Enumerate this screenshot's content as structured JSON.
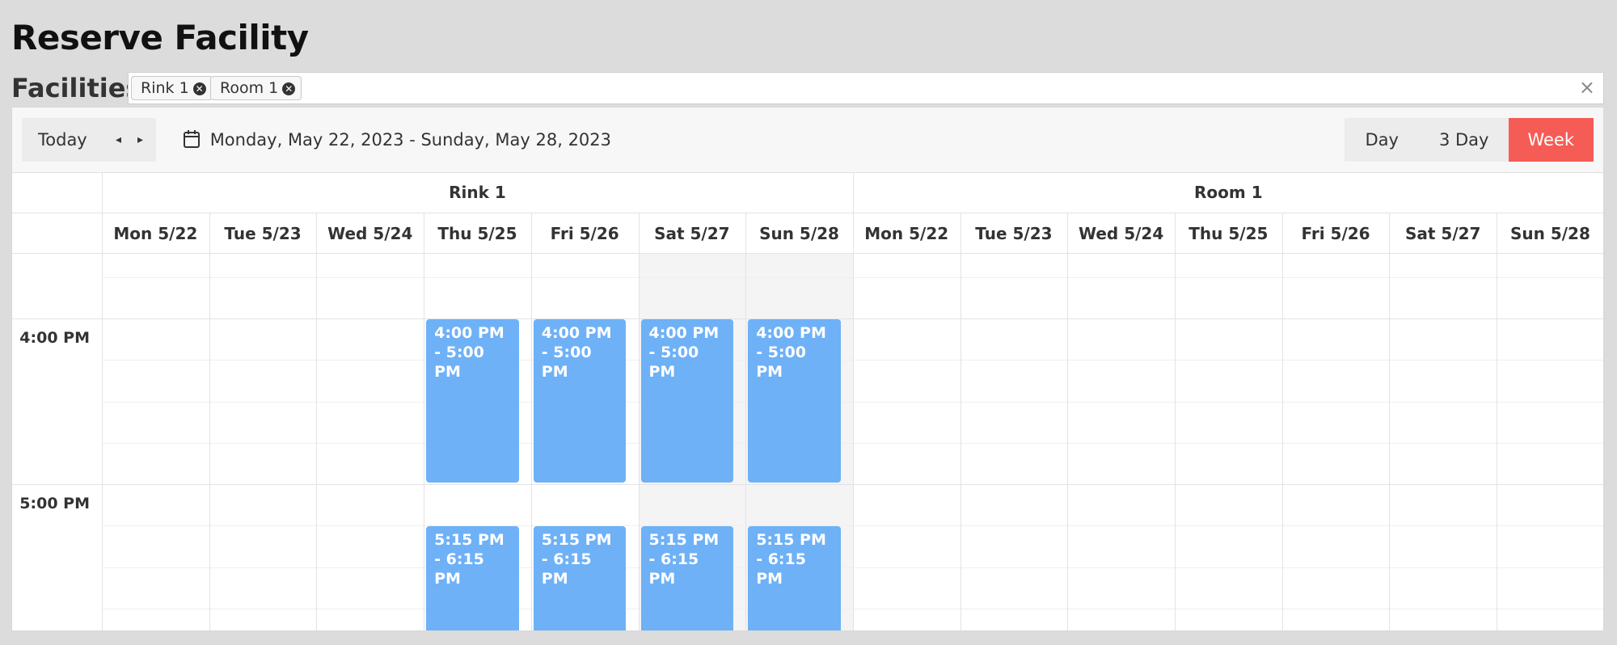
{
  "page": {
    "title": "Reserve Facility"
  },
  "facilities": {
    "label": "Facilities",
    "chips": [
      {
        "label": "Rink 1",
        "remove_icon": "close-circle-icon"
      },
      {
        "label": "Room 1",
        "remove_icon": "close-circle-icon"
      }
    ],
    "clear_icon": "close-icon",
    "clear_glyph": "×"
  },
  "toolbar": {
    "today_label": "Today",
    "prev_glyph": "◂",
    "next_glyph": "▸",
    "range_text": "Monday, May 22, 2023 - Sunday, May 28, 2023",
    "views": [
      "Day",
      "3 Day",
      "Week"
    ],
    "active_view": "Week"
  },
  "calendar": {
    "resources": [
      "Rink 1",
      "Room 1"
    ],
    "days": [
      "Mon 5/22",
      "Tue 5/23",
      "Wed 5/24",
      "Thu 5/25",
      "Fri 5/26",
      "Sat 5/27",
      "Sun 5/28"
    ],
    "time_labels": [
      "4:00 PM",
      "5:00 PM"
    ],
    "events": [
      {
        "resource": 0,
        "day": 3,
        "text": "4:00 PM - 5:00 PM"
      },
      {
        "resource": 0,
        "day": 4,
        "text": "4:00 PM - 5:00 PM"
      },
      {
        "resource": 0,
        "day": 5,
        "text": "4:00 PM - 5:00 PM"
      },
      {
        "resource": 0,
        "day": 6,
        "text": "4:00 PM - 5:00 PM"
      },
      {
        "resource": 0,
        "day": 3,
        "text": "5:15 PM - 6:15 PM"
      },
      {
        "resource": 0,
        "day": 4,
        "text": "5:15 PM - 6:15 PM"
      },
      {
        "resource": 0,
        "day": 5,
        "text": "5:15 PM - 6:15 PM"
      },
      {
        "resource": 0,
        "day": 6,
        "text": "5:15 PM - 6:15 PM"
      }
    ],
    "colors": {
      "event": "#6eb1f7",
      "active_view": "#f55c55",
      "weekend": "#f4f4f4"
    }
  }
}
